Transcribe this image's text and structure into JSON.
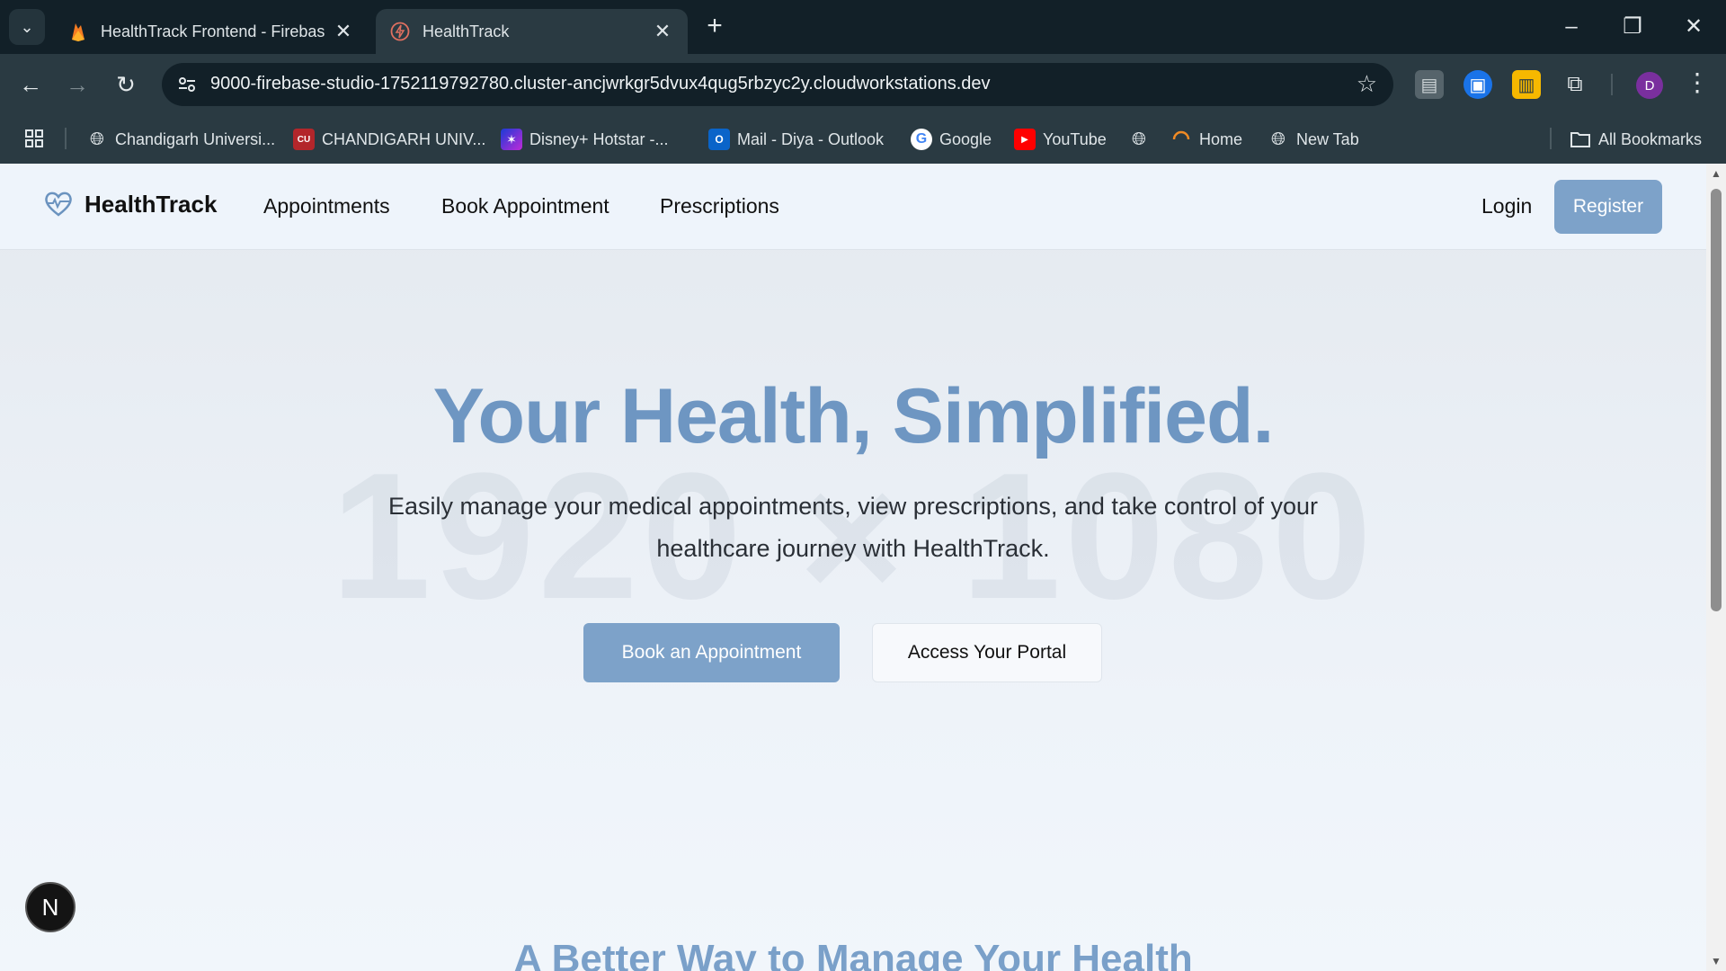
{
  "browser": {
    "tabs": [
      {
        "title": "HealthTrack Frontend - Firebase Studio",
        "active": false
      },
      {
        "title": "HealthTrack",
        "active": true
      }
    ],
    "url": "9000-firebase-studio-1752119792780.cluster-ancjwrkgr5dvux4qug5rbzyc2y.cloudworkstations.dev",
    "profile_initial": "D",
    "bookmarks": [
      {
        "label": "Chandigarh Universi...",
        "icon": "globe-icon"
      },
      {
        "label": "CHANDIGARH UNIV...",
        "icon": "cu-logo-icon"
      },
      {
        "label": "Disney+ Hotstar -...",
        "icon": "hotstar-icon"
      },
      {
        "label": "Mail - Diya - Outlook",
        "icon": "outlook-icon"
      },
      {
        "label": "Google",
        "icon": "google-icon"
      },
      {
        "label": "YouTube",
        "icon": "youtube-icon"
      },
      {
        "label": "",
        "icon": "globe-icon"
      },
      {
        "label": "Home",
        "icon": "home-arc-icon"
      },
      {
        "label": "New Tab",
        "icon": "globe-icon"
      }
    ],
    "all_bookmarks": "All Bookmarks"
  },
  "site": {
    "brand": "HealthTrack",
    "nav": [
      "Appointments",
      "Book Appointment",
      "Prescriptions"
    ],
    "login": "Login",
    "register": "Register"
  },
  "hero": {
    "title": "Your Health, Simplified.",
    "subtitle": "Easily manage your medical appointments, view prescriptions, and take control of your healthcare journey with HealthTrack.",
    "primary_cta": "Book an Appointment",
    "secondary_cta": "Access Your Portal",
    "watermark": "1920 × 1080"
  },
  "next_section_title": "A Better Way to Manage Your Health",
  "badge_letter": "N",
  "colors": {
    "accent": "#7da2c9",
    "title": "#6e96c2",
    "chrome_dark": "#122028",
    "chrome_toolbar": "#2a3a42"
  }
}
